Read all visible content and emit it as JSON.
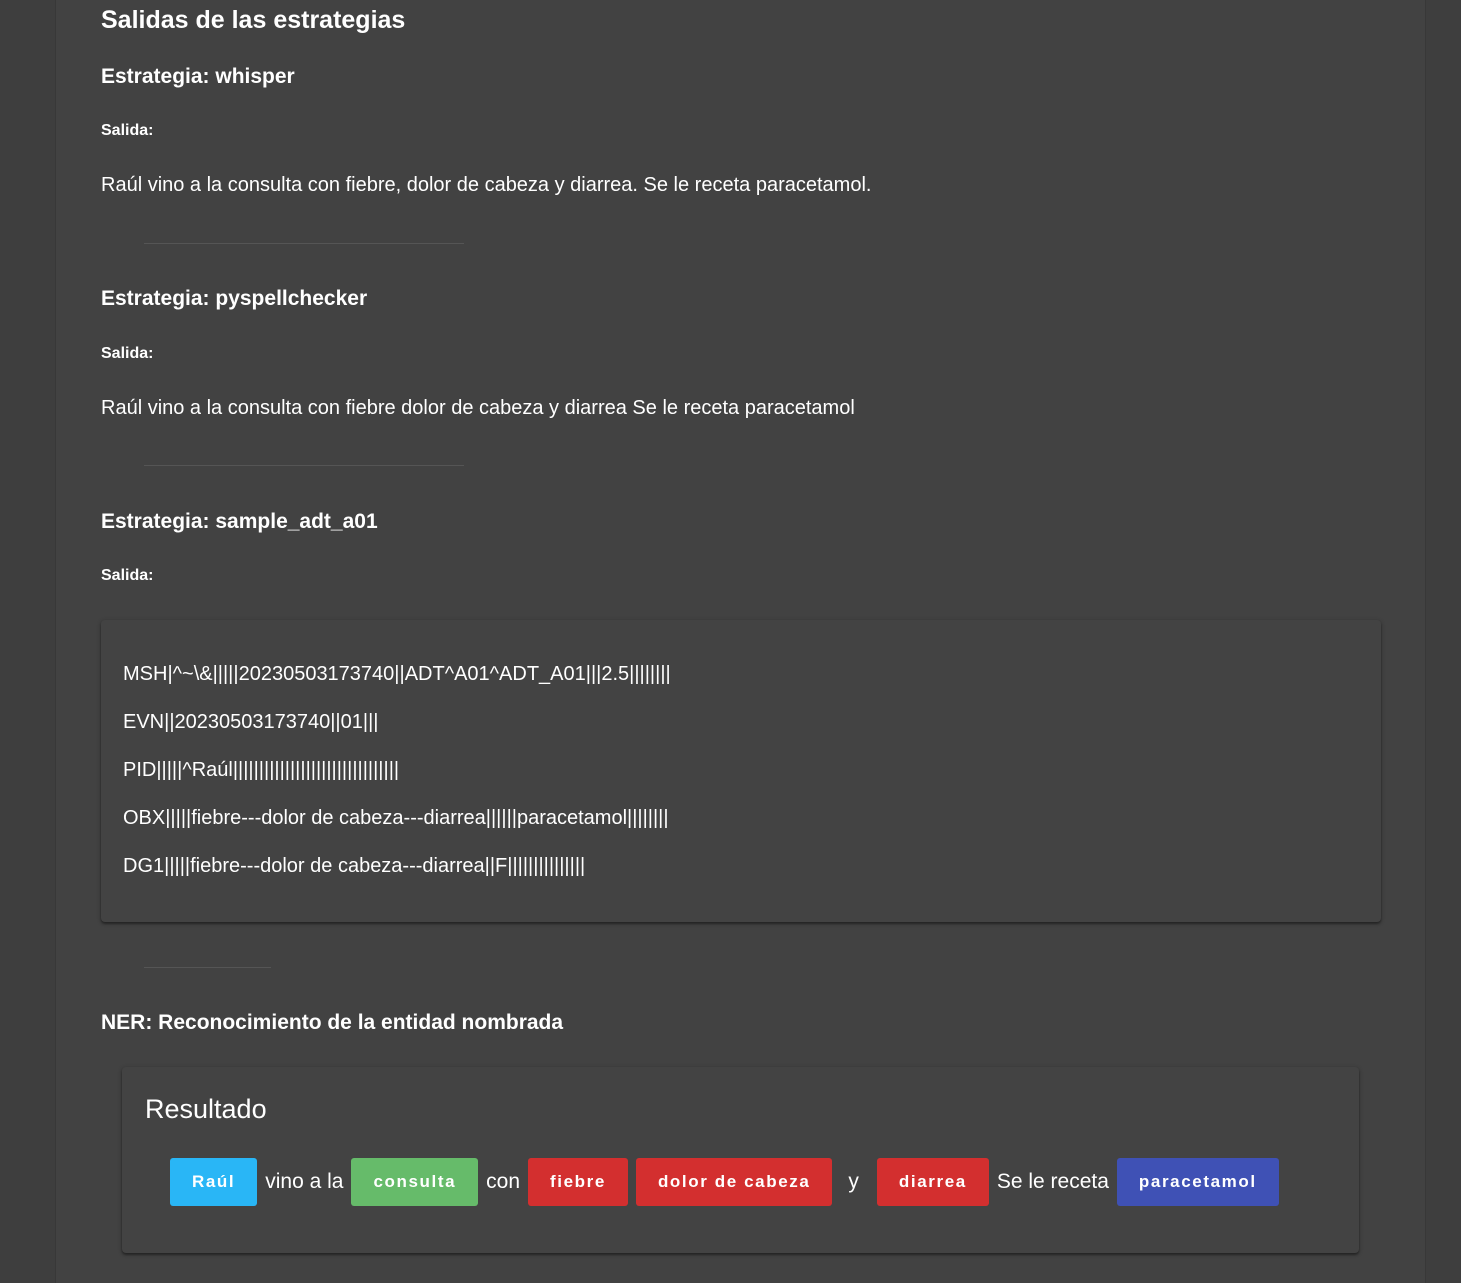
{
  "page": {
    "section_title": "Salidas de las estrategias"
  },
  "strategies": [
    {
      "title": "Estrategia: whisper",
      "salida_label": "Salida:",
      "output": "Raúl vino a la consulta con fiebre, dolor de cabeza y diarrea. Se le receta paracetamol."
    },
    {
      "title": "Estrategia: pyspellchecker",
      "salida_label": "Salida:",
      "output": "Raúl vino a la consulta con fiebre dolor de cabeza y diarrea Se le receta paracetamol"
    },
    {
      "title": "Estrategia: sample_adt_a01",
      "salida_label": "Salida:",
      "hl7_lines": [
        "MSH|^~\\&|||||20230503173740||ADT^A01^ADT_A01|||2.5||||||||",
        "EVN||20230503173740||01|||",
        "PID|||||^Raúl||||||||||||||||||||||||||||||||",
        "OBX|||||fiebre---dolor de cabeza---diarrea||||||paracetamol||||||||",
        "DG1|||||fiebre---dolor de cabeza---diarrea||F|||||||||||||||"
      ]
    }
  ],
  "ner": {
    "title": "NER: Reconocimiento de la entidad nombrada",
    "result_title": "Resultado",
    "tokens": [
      {
        "text": "Raúl",
        "entity": true,
        "color": "#29b6f6"
      },
      {
        "text": "vino a la",
        "entity": false
      },
      {
        "text": "consulta",
        "entity": true,
        "color": "#66bb6a"
      },
      {
        "text": "con",
        "entity": false
      },
      {
        "text": "fiebre",
        "entity": true,
        "color": "#d32f2f"
      },
      {
        "text": "dolor de cabeza",
        "entity": true,
        "color": "#d32f2f"
      },
      {
        "text": "y",
        "entity": false
      },
      {
        "text": "diarrea",
        "entity": true,
        "color": "#d32f2f"
      },
      {
        "text": "Se le receta",
        "entity": false
      },
      {
        "text": "paracetamol",
        "entity": true,
        "color": "#3f51b5"
      }
    ]
  }
}
